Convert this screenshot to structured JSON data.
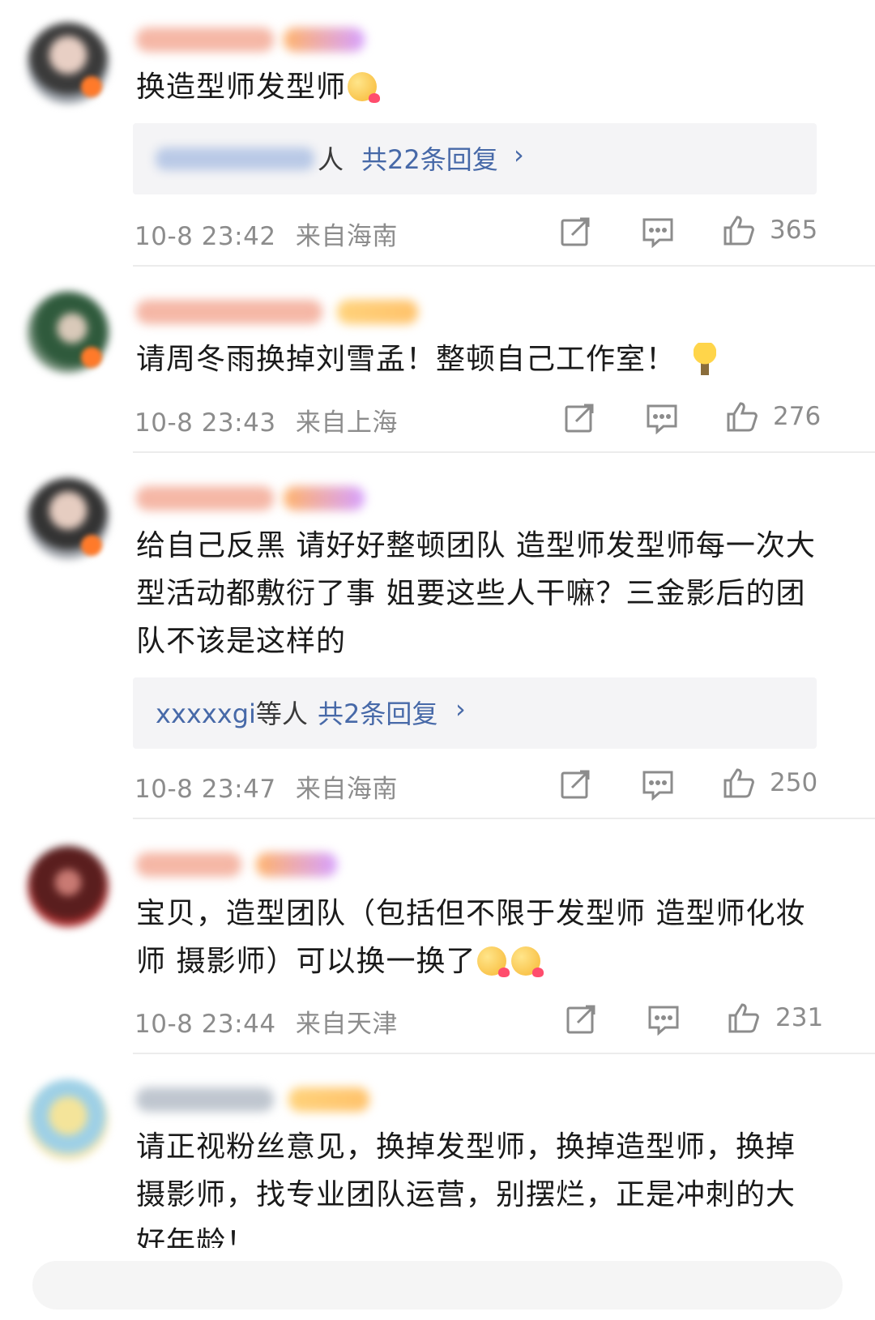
{
  "comments": [
    {
      "text": "换造型师发型师",
      "reply": {
        "names_suffix": "人",
        "count": "共22条回复",
        "chevron": "›"
      },
      "meta": {
        "time": "10-8 23:42",
        "location": "来自海南"
      },
      "likes": "365"
    },
    {
      "text": "请周冬雨换掉刘雪孟！整顿自己工作室！",
      "meta": {
        "time": "10-8 23:43",
        "location": "来自上海"
      },
      "likes": "276"
    },
    {
      "text": "给自己反黑 请好好整顿团队 造型师发型师每一次大型活动都敷衍了事 姐要这些人干嘛？三金影后的团队不该是这样的",
      "reply": {
        "names": "xxxxxgi",
        "names_suffix": "等人",
        "count": "共2条回复",
        "chevron": "›"
      },
      "meta": {
        "time": "10-8 23:47",
        "location": "来自海南"
      },
      "likes": "250"
    },
    {
      "text": "宝贝，造型团队（包括但不限于发型师 造型师化妆师 摄影师）可以换一换了",
      "meta": {
        "time": "10-8 23:44",
        "location": "来自天津"
      },
      "likes": "231"
    },
    {
      "text": "请正视粉丝意见，换掉发型师，换掉造型师，换掉摄影师，找专业团队运营，别摆烂，正是冲刺的大好年龄！"
    }
  ],
  "icons": {
    "share": "share-icon",
    "comment": "comment-icon",
    "like": "thumbs-up-icon",
    "emoji": "face-emoji-icon",
    "lightbulb": "lightbulb-emoji-icon"
  },
  "colors": {
    "link": "#4769a8",
    "meta": "#8c8c8c",
    "reply_bg": "#f4f4f6"
  }
}
